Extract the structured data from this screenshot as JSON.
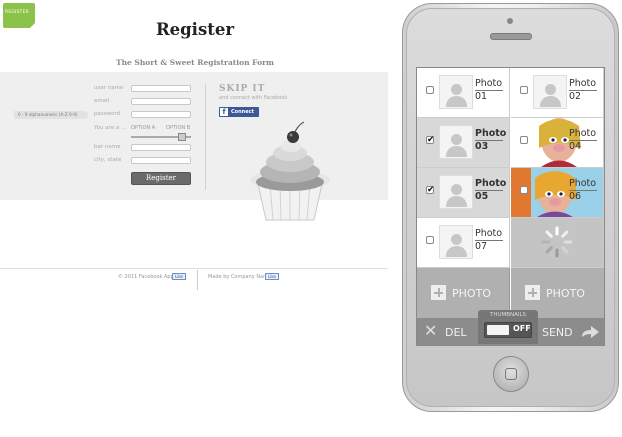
{
  "badge": {
    "text": "REGISTER"
  },
  "register": {
    "title": "Register",
    "subtitle": "The Short & Sweet Registration Form",
    "slug_text": "0 - 9 alphanumeric  (A-Z 0-9)",
    "fields": [
      {
        "label": "user name"
      },
      {
        "label": "email"
      },
      {
        "label": "password"
      },
      {
        "label": "You are a ..."
      },
      {
        "label": "bar name"
      },
      {
        "label": "city, state"
      }
    ],
    "option_a": "OPTION A",
    "option_b": "OPTION B",
    "button": "Register"
  },
  "skip": {
    "title": "SKIP IT",
    "subtitle": "and connect with Facebook",
    "fb_f": "f",
    "fb_connect": "Connect"
  },
  "footer": {
    "left_text": "© 2011 Facebook App",
    "left_badge": "Like",
    "right_text": "Made by Company Name",
    "right_badge": "Like"
  },
  "phone": {
    "photos": [
      {
        "label": "Photo",
        "num": "01",
        "checked": false
      },
      {
        "label": "Photo",
        "num": "02",
        "checked": false
      },
      {
        "label": "Photo",
        "num": "03",
        "checked": true
      },
      {
        "label": "Photo",
        "num": "04",
        "checked": false
      },
      {
        "label": "Photo",
        "num": "05",
        "checked": true
      },
      {
        "label": "Photo",
        "num": "06",
        "checked": false
      },
      {
        "label": "Photo",
        "num": "07",
        "checked": false
      }
    ],
    "add_left": "PHOTO",
    "add_right": "PHOTO",
    "toolbar": {
      "del": "DEL",
      "thumbnails": "THUMBNAILS",
      "toggle": "OFF",
      "send": "SEND"
    }
  }
}
